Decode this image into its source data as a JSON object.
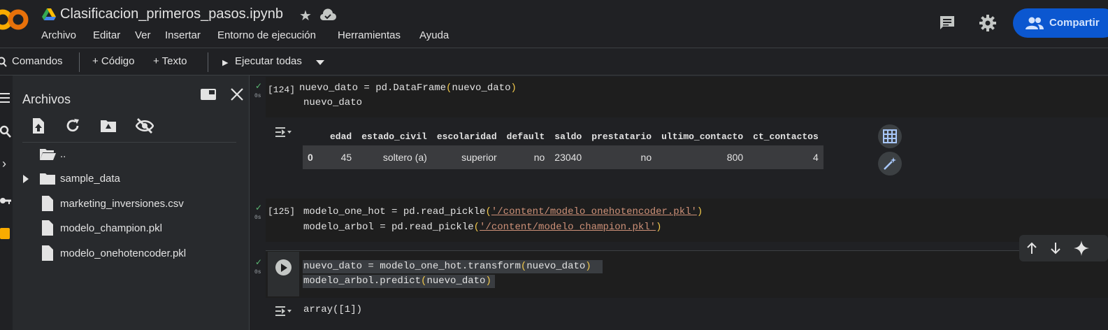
{
  "app": {
    "title": "Clasificacion_primeros_pasos.ipynb",
    "share_label": "Compartir",
    "menu": [
      "Archivo",
      "Editar",
      "Ver",
      "Insertar",
      "Entorno de ejecución",
      "Herramientas",
      "Ayuda"
    ],
    "colors": {
      "background": "#202124",
      "share": "#0b57d0",
      "accent": "#f9ab00"
    }
  },
  "toolbar": {
    "commands_label": "Comandos",
    "add_code_label": "+ Código",
    "add_text_label": "+ Texto",
    "run_all_label": "Ejecutar todas"
  },
  "files_panel": {
    "title": "Archivos",
    "items": [
      {
        "name": "..",
        "type": "folder"
      },
      {
        "name": "sample_data",
        "type": "folder"
      },
      {
        "name": "marketing_inversiones.csv",
        "type": "file"
      },
      {
        "name": "modelo_champion.pkl",
        "type": "file"
      },
      {
        "name": "modelo_onehotencoder.pkl",
        "type": "file"
      }
    ]
  },
  "cells": {
    "c1": {
      "exec": "[124]",
      "time": "0s",
      "line1_a": "nuevo_dato = pd.DataFrame",
      "line1_p1": "(",
      "line1_b": "nuevo_dato",
      "line1_p2": ")",
      "line2": "nuevo_dato"
    },
    "df": {
      "columns": [
        "edad",
        "estado_civil",
        "escolaridad",
        "default",
        "saldo",
        "prestatario",
        "ultimo_contacto",
        "ct_contactos"
      ],
      "index": "0",
      "row": [
        "45",
        "soltero (a)",
        "superior",
        "no",
        "23040",
        "no",
        "800",
        "4"
      ]
    },
    "c2": {
      "exec": "[125]",
      "time": "0s",
      "line1_a": "modelo_one_hot = pd.read_pickle",
      "line1_p1": "(",
      "line1_s": "'/content/modelo_onehotencoder.pkl'",
      "line1_p2": ")",
      "line2_a": "modelo_arbol = pd.read_pickle",
      "line2_p1": "(",
      "line2_s": "'/content/modelo_champion.pkl'",
      "line2_p2": ")"
    },
    "c3": {
      "time": "0s",
      "line1_a": "nuevo_dato = modelo_one_hot.transform",
      "line1_p1": "(",
      "line1_b": "nuevo_dato",
      "line1_p2": ")",
      "line2_a": "modelo_arbol.predict",
      "line2_p1": "(",
      "line2_b": "nuevo_dato",
      "line2_p2": ")",
      "output": "array([1])"
    }
  }
}
